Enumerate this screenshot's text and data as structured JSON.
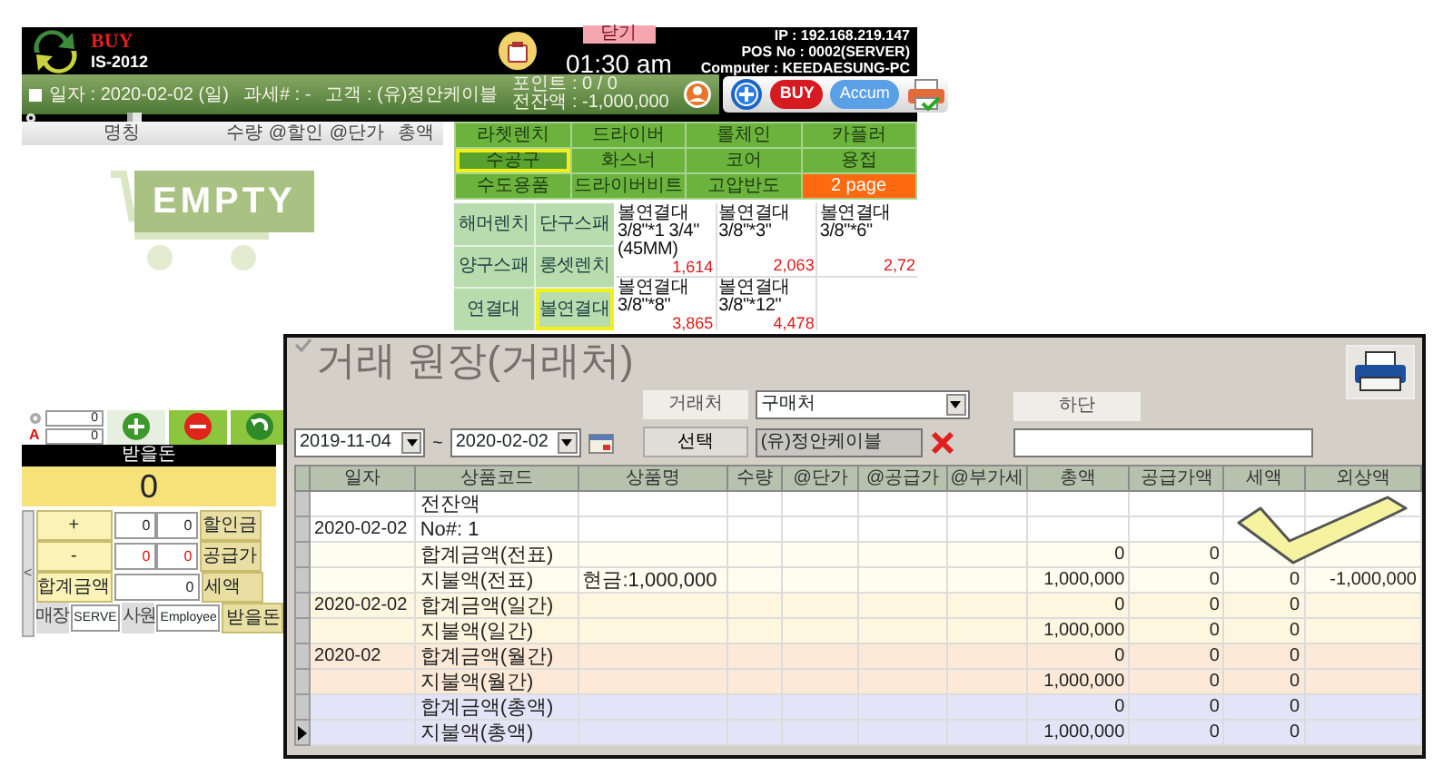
{
  "pos_window": {
    "header": {
      "logo_text": "BUY",
      "logo_subtext": "IS-2012",
      "close_button": "닫기",
      "time": "01:30 am",
      "ip": "IP : 192.168.219.147",
      "pos_no": "POS No : 0002(SERVER)",
      "computer": "Computer : KEEDAESUNG-PC"
    },
    "info_bar": {
      "date": "일자 : 2020-02-02 (일)",
      "tax_no": "과세# : -",
      "customer": "고객 : (유)정안케이블",
      "points": "포인트 : 0 / 0",
      "previous_balance": "전잔액 : -1,000,000"
    },
    "toolbar": [
      {
        "kind": "add"
      },
      {
        "kind": "buy",
        "label": "BUY"
      },
      {
        "kind": "accum",
        "label": "Accum"
      },
      {
        "kind": "print"
      }
    ],
    "cart": {
      "columns": [
        "명칭",
        "수량",
        "@할인",
        "@단가",
        "총액"
      ],
      "empty_label": "EMPTY"
    },
    "categories": [
      {
        "label": "라쳇렌치",
        "kind": "category",
        "selected": false
      },
      {
        "label": "드라이버",
        "kind": "category",
        "selected": false
      },
      {
        "label": "롤체인",
        "kind": "category",
        "selected": false
      },
      {
        "label": "카플러",
        "kind": "category",
        "selected": false
      },
      {
        "label": "수공구",
        "kind": "category",
        "selected": true
      },
      {
        "label": "화스너",
        "kind": "category",
        "selected": false
      },
      {
        "label": "코어",
        "kind": "category",
        "selected": false
      },
      {
        "label": "용접",
        "kind": "category",
        "selected": false
      },
      {
        "label": "수도용품",
        "kind": "category",
        "selected": false
      },
      {
        "label": "드라이버비트",
        "kind": "category",
        "selected": false
      },
      {
        "label": "고압반도",
        "kind": "category",
        "selected": false
      },
      {
        "label": "2 page",
        "kind": "page",
        "selected": false
      }
    ],
    "subcategories": [
      {
        "label": "해머렌치",
        "selected": false
      },
      {
        "label": "단구스패",
        "selected": false
      },
      {
        "label": "양구스패",
        "selected": false
      },
      {
        "label": "롱셋렌치",
        "selected": false
      },
      {
        "label": "연결대",
        "selected": false
      },
      {
        "label": "볼연결대",
        "selected": true
      }
    ],
    "products": [
      {
        "name": "볼연결대 3/8\"*1 3/4\"(45MM)",
        "price": "1,614"
      },
      {
        "name": "볼연결대 3/8\"*3\"",
        "price": "2,063"
      },
      {
        "name": "볼연결대 3/8\"*6\"",
        "price": "2,72"
      },
      {
        "name": "볼연결대 3/8\"*8\"",
        "price": "3,865"
      },
      {
        "name": "볼연결대 3/8\"*12\"",
        "price": "4,478"
      }
    ],
    "quantity_inputs": [
      "0",
      "0"
    ],
    "discount_marker": "A",
    "action_buttons": [
      {
        "kind": "plus"
      },
      {
        "kind": "minus"
      },
      {
        "kind": "undo"
      }
    ],
    "amount_due": {
      "label": "받을돈",
      "value": "0"
    },
    "summary": {
      "collapse_arrow": "<",
      "plus_label": "+",
      "plus_values": [
        "0",
        "0"
      ],
      "minus_label": "-",
      "minus_values": [
        "0",
        "0"
      ],
      "total_label": "합계금액",
      "total_value": "0",
      "store_label": "매장",
      "store_value": "SERVE",
      "staff_label": "사원",
      "staff_value": "Employee",
      "right_labels": [
        "할인금",
        "공급가",
        "세액",
        "받을돈"
      ]
    }
  },
  "ledger_dialog": {
    "title": "거래 원장(거래처)",
    "date_from": "2019-11-04",
    "date_separator": "~",
    "date_to": "2020-02-02",
    "partner_label": "거래처",
    "partner_type": "구매처",
    "select_button": "선택",
    "partner_name": "(유)정안케이블",
    "bottom_label": "하단",
    "columns": [
      "일자",
      "상품코드",
      "상품명",
      "수량",
      "@단가",
      "@공급가",
      "@부가세",
      "총액",
      "공급가액",
      "세액",
      "외상액"
    ],
    "rows": [
      {
        "kind": "balance",
        "selected": false,
        "code": "전잔액"
      },
      {
        "kind": "slip",
        "selected": false,
        "date": "2020-02-02",
        "code": "No#: 1"
      },
      {
        "kind": "slip_total",
        "selected": false,
        "code": "합계금액(전표)",
        "total": "0",
        "supply": "0"
      },
      {
        "kind": "slip_total",
        "selected": false,
        "code": "지불액(전표)",
        "name": "현금:1,000,000",
        "total": "1,000,000",
        "supply": "0",
        "tax": "0",
        "credit": "-1,000,000"
      },
      {
        "kind": "daily",
        "selected": false,
        "date": "2020-02-02",
        "code": "합계금액(일간)",
        "total": "0",
        "supply": "0",
        "tax": "0"
      },
      {
        "kind": "daily",
        "selected": false,
        "code": "지불액(일간)",
        "total": "1,000,000",
        "supply": "0",
        "tax": "0"
      },
      {
        "kind": "monthly",
        "selected": false,
        "date": "2020-02",
        "code": "합계금액(월간)",
        "total": "0",
        "supply": "0",
        "tax": "0"
      },
      {
        "kind": "monthly",
        "selected": false,
        "code": "지불액(월간)",
        "total": "1,000,000",
        "supply": "0",
        "tax": "0"
      },
      {
        "kind": "grand",
        "selected": false,
        "code": "합계금액(총액)",
        "total": "0",
        "supply": "0",
        "tax": "0"
      },
      {
        "kind": "grand",
        "selected": true,
        "code": "지불액(총액)",
        "total": "1,000,000",
        "supply": "0",
        "tax": "0"
      }
    ]
  }
}
